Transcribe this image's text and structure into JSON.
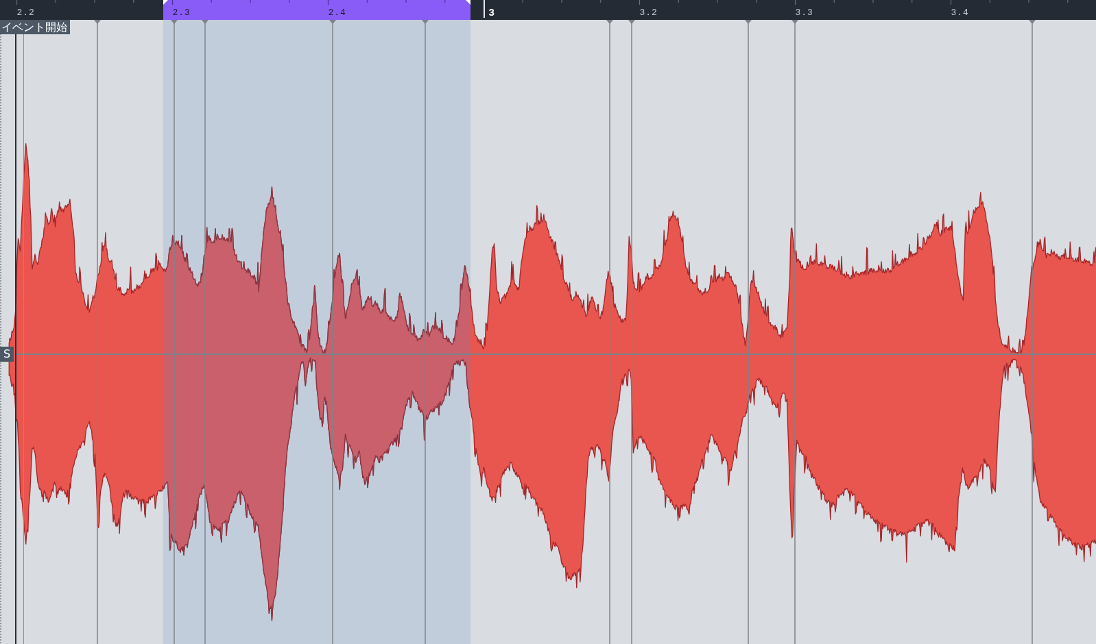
{
  "ruler": {
    "labels": [
      {
        "text": "2.2",
        "kind": "beat",
        "in_range": false
      },
      {
        "text": "2.3",
        "kind": "beat",
        "in_range": true
      },
      {
        "text": "2.4",
        "kind": "beat",
        "in_range": true
      },
      {
        "text": "3",
        "kind": "bar",
        "in_range": false
      },
      {
        "text": "3.2",
        "kind": "beat",
        "in_range": false
      },
      {
        "text": "3.3",
        "kind": "beat",
        "in_range": false
      },
      {
        "text": "3.4",
        "kind": "beat",
        "in_range": false
      }
    ]
  },
  "event": {
    "start_label": "イベント開始",
    "sync_label": "S"
  }
}
